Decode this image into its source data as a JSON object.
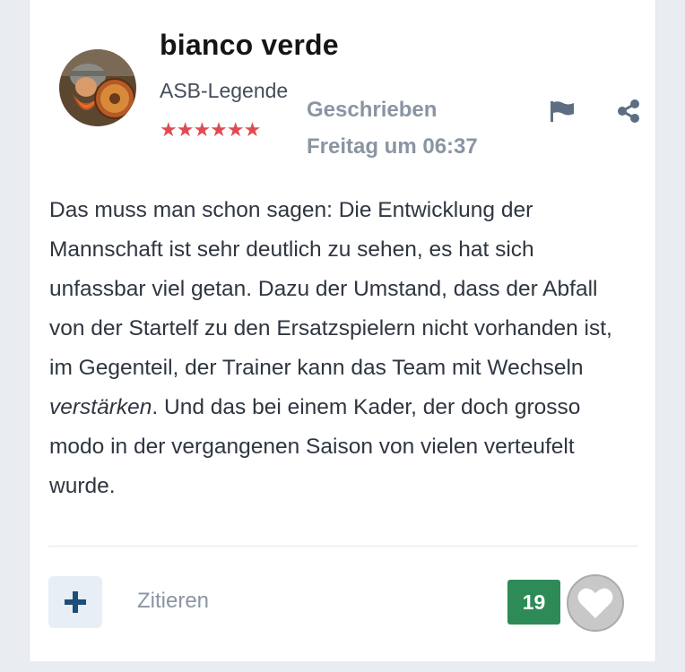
{
  "author": {
    "name": "bianco verde",
    "rank": "ASB-Legende",
    "stars": "★★★★★★"
  },
  "post": {
    "posted_label": "Geschrieben",
    "posted_time": "Freitag um 06:37",
    "body_before_em": "Das muss man schon sagen: Die Entwicklung der Mannschaft ist sehr deutlich zu sehen, es hat sich unfassbar viel getan. Dazu der Umstand, dass der Abfall von der Startelf zu den Ersatzspielern nicht vorhanden ist, im Gegenteil, der Trainer kann das Team mit Wechseln ",
    "body_em": "verstärken",
    "body_after_em": ". Und das bei einem Kader, der doch grosso modo in der vergangenen Saison von vielen verteufelt wurde."
  },
  "actions": {
    "plus_label": "+",
    "quote_label": "Zitieren",
    "like_count": "19"
  },
  "icons": {
    "flag": "flag-icon",
    "share": "share-icon",
    "heart": "heart-icon"
  },
  "colors": {
    "like_badge": "#2e8b57",
    "stars": "#e04b53",
    "muted_text": "#8a95a3",
    "plus_button_bg": "#e7eef6",
    "plus_glyph": "#1d4e79"
  }
}
